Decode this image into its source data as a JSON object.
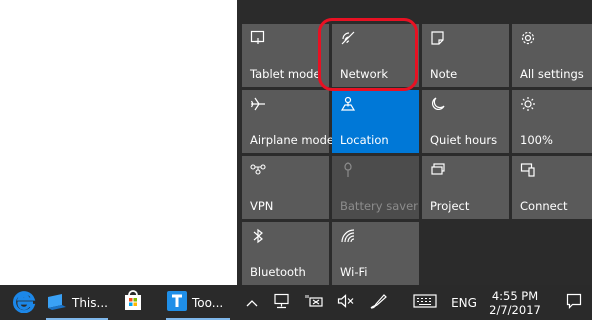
{
  "action_center": {
    "tiles": [
      {
        "label": "Tablet mode",
        "icon": "tablet-mode-icon",
        "state": "normal"
      },
      {
        "label": "Network",
        "icon": "network-icon",
        "state": "normal"
      },
      {
        "label": "Note",
        "icon": "note-icon",
        "state": "normal"
      },
      {
        "label": "All settings",
        "icon": "gear-icon",
        "state": "normal"
      },
      {
        "label": "Airplane mode",
        "icon": "airplane-icon",
        "state": "normal"
      },
      {
        "label": "Location",
        "icon": "location-icon",
        "state": "active"
      },
      {
        "label": "Quiet hours",
        "icon": "moon-icon",
        "state": "normal"
      },
      {
        "label": "100%",
        "icon": "brightness-icon",
        "state": "normal"
      },
      {
        "label": "VPN",
        "icon": "vpn-icon",
        "state": "normal"
      },
      {
        "label": "Battery saver",
        "icon": "battery-saver-icon",
        "state": "disabled"
      },
      {
        "label": "Project",
        "icon": "project-icon",
        "state": "normal"
      },
      {
        "label": "Connect",
        "icon": "connect-icon",
        "state": "normal"
      },
      {
        "label": "Bluetooth",
        "icon": "bluetooth-icon",
        "state": "normal"
      },
      {
        "label": "Wi-Fi",
        "icon": "wifi-icon",
        "state": "normal"
      }
    ]
  },
  "taskbar": {
    "apps": [
      {
        "label": "",
        "icon": "edge-icon"
      },
      {
        "label": "This...",
        "icon": "this-pc-icon"
      },
      {
        "label": "",
        "icon": "store-icon"
      },
      {
        "label": "Too...",
        "icon": "toolbox-icon"
      }
    ],
    "tray": {
      "language": "ENG",
      "time": "4:55 PM",
      "date": "2/7/2017"
    }
  },
  "colors": {
    "tile": "#5a5a5a",
    "tile_active": "#0078d7",
    "highlight": "#e81123",
    "taskbar": "#2a2a2a"
  }
}
